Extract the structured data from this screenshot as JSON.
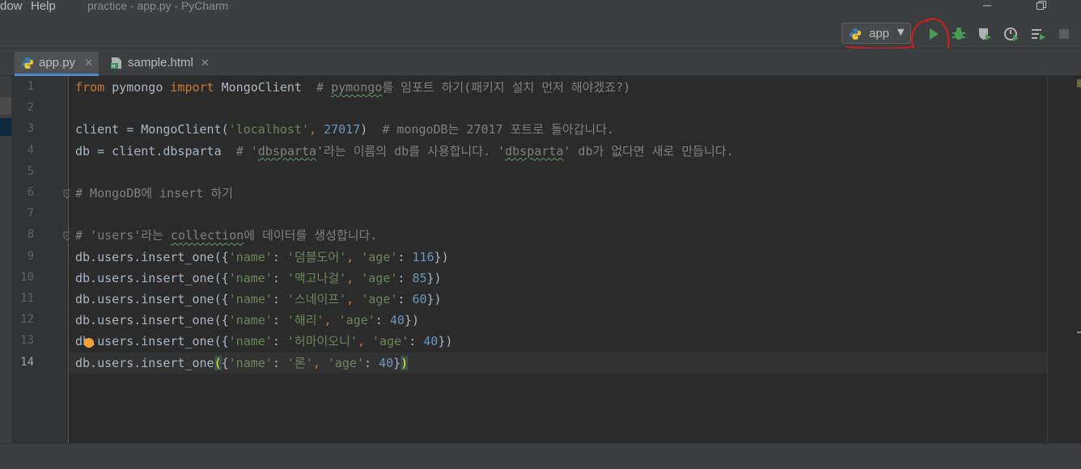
{
  "menu": {
    "items": [
      "dow",
      "Help"
    ],
    "window_title": "practice - app.py - PyCharm"
  },
  "toolbar": {
    "run_config": "app",
    "icons": [
      "python-icon",
      "chevron-down-icon",
      "run-icon",
      "debug-icon",
      "coverage-icon",
      "profile-icon",
      "concurrency-icon",
      "stop-icon"
    ]
  },
  "tabs": [
    {
      "label": "app.py",
      "active": true
    },
    {
      "label": "sample.html",
      "active": false
    }
  ],
  "editor": {
    "current_line": 14,
    "line_numbers": [
      "1",
      "2",
      "3",
      "4",
      "5",
      "6",
      "7",
      "8",
      "9",
      "10",
      "11",
      "12",
      "13",
      "14"
    ],
    "lines": [
      {
        "segs": [
          [
            "kw",
            "from"
          ],
          [
            "p",
            " pymongo "
          ],
          [
            "kw",
            "import"
          ],
          [
            "p",
            " MongoClient  "
          ],
          [
            "cm",
            "# "
          ],
          [
            "cmt",
            "pymongo"
          ],
          [
            "cm",
            "를 임포트 하기(패키지 설치 먼저 해야겠죠?)"
          ]
        ]
      },
      {
        "segs": []
      },
      {
        "segs": [
          [
            "p",
            "client = MongoClient("
          ],
          [
            "str",
            "'localhost'"
          ],
          [
            "kw",
            ", "
          ],
          [
            "num",
            "27017"
          ],
          [
            "p",
            ")  "
          ],
          [
            "cm",
            "# mongoDB는 27017 포트로 돌아갑니다."
          ]
        ]
      },
      {
        "segs": [
          [
            "p",
            "db = client.dbsparta  "
          ],
          [
            "cm",
            "# '"
          ],
          [
            "cmt",
            "dbsparta"
          ],
          [
            "cm",
            "'라는 이름의 db를 사용합니다. '"
          ],
          [
            "cmt",
            "dbsparta"
          ],
          [
            "cm",
            "' db가 없다면 새로 만듭니다."
          ]
        ]
      },
      {
        "segs": []
      },
      {
        "segs": [
          [
            "cm",
            "# MongoDB에 insert 하기"
          ]
        ]
      },
      {
        "segs": []
      },
      {
        "segs": [
          [
            "cm",
            "# 'users'라는 "
          ],
          [
            "cmt",
            "collection"
          ],
          [
            "cm",
            "에 데이터를 생성합니다."
          ]
        ]
      },
      {
        "segs": [
          [
            "p",
            "db.users.insert_one({"
          ],
          [
            "str",
            "'name'"
          ],
          [
            "p",
            ": "
          ],
          [
            "str",
            "'덤블도어'"
          ],
          [
            "kw",
            ", "
          ],
          [
            "str",
            "'age'"
          ],
          [
            "p",
            ": "
          ],
          [
            "num",
            "116"
          ],
          [
            "p",
            "})"
          ]
        ]
      },
      {
        "segs": [
          [
            "p",
            "db.users.insert_one({"
          ],
          [
            "str",
            "'name'"
          ],
          [
            "p",
            ": "
          ],
          [
            "str",
            "'맥고나걸'"
          ],
          [
            "kw",
            ", "
          ],
          [
            "str",
            "'age'"
          ],
          [
            "p",
            ": "
          ],
          [
            "num",
            "85"
          ],
          [
            "p",
            "})"
          ]
        ]
      },
      {
        "segs": [
          [
            "p",
            "db.users.insert_one({"
          ],
          [
            "str",
            "'name'"
          ],
          [
            "p",
            ": "
          ],
          [
            "str",
            "'스네이프'"
          ],
          [
            "kw",
            ", "
          ],
          [
            "str",
            "'age'"
          ],
          [
            "p",
            ": "
          ],
          [
            "num",
            "60"
          ],
          [
            "p",
            "})"
          ]
        ]
      },
      {
        "segs": [
          [
            "p",
            "db.users.insert_one({"
          ],
          [
            "str",
            "'name'"
          ],
          [
            "p",
            ": "
          ],
          [
            "str",
            "'해리'"
          ],
          [
            "kw",
            ", "
          ],
          [
            "str",
            "'age'"
          ],
          [
            "p",
            ": "
          ],
          [
            "num",
            "40"
          ],
          [
            "p",
            "})"
          ]
        ]
      },
      {
        "segs": [
          [
            "p",
            "db.users.insert_one({"
          ],
          [
            "str",
            "'name'"
          ],
          [
            "p",
            ": "
          ],
          [
            "str",
            "'허마이오니'"
          ],
          [
            "kw",
            ", "
          ],
          [
            "str",
            "'age'"
          ],
          [
            "p",
            ": "
          ],
          [
            "num",
            "40"
          ],
          [
            "p",
            "})"
          ]
        ]
      },
      {
        "segs": [
          [
            "p",
            "db.users.insert_one"
          ],
          [
            "hi",
            "("
          ],
          [
            "p",
            "{"
          ],
          [
            "str",
            "'name'"
          ],
          [
            "p",
            ": "
          ],
          [
            "str",
            "'론'"
          ],
          [
            "kw",
            ", "
          ],
          [
            "str",
            "'age'"
          ],
          [
            "p",
            ": "
          ],
          [
            "num",
            "40"
          ],
          [
            "p",
            "}"
          ],
          [
            "hi",
            ")"
          ]
        ]
      }
    ]
  },
  "colors": {
    "accent": "#4a88c7",
    "keyword": "#cc7832",
    "string": "#6a8759",
    "number": "#6897bb",
    "comment": "#808080",
    "run_green": "#499c54"
  }
}
